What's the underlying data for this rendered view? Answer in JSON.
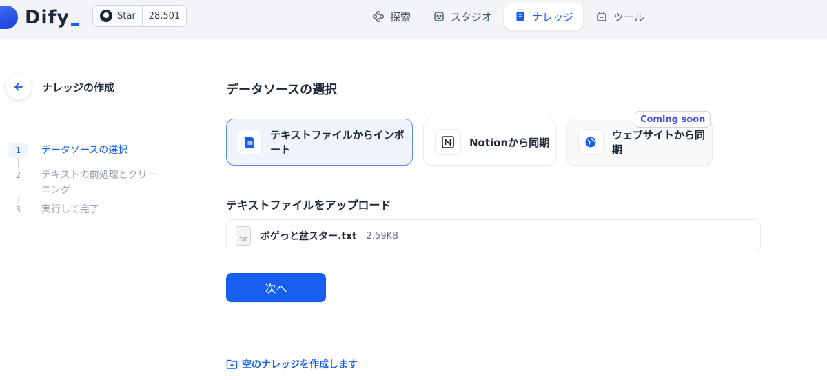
{
  "app": {
    "name": "Dify"
  },
  "github": {
    "star_label": "Star",
    "star_count": "28,501"
  },
  "nav": {
    "items": [
      {
        "label": "探索",
        "icon": "explore-icon",
        "active": false
      },
      {
        "label": "スタジオ",
        "icon": "studio-icon",
        "active": false
      },
      {
        "label": "ナレッジ",
        "icon": "knowledge-icon",
        "active": true
      },
      {
        "label": "ツール",
        "icon": "tools-icon",
        "active": false
      }
    ]
  },
  "sidebar": {
    "title": "ナレッジの作成",
    "steps": [
      {
        "num": "1",
        "label": "データソースの選択",
        "active": true
      },
      {
        "num": "2",
        "label": "テキストの前処理とクリーニング",
        "active": false
      },
      {
        "num": "3",
        "label": "実行して完了",
        "active": false
      }
    ]
  },
  "main": {
    "section_title": "データソースの選択",
    "sources": [
      {
        "label": "テキストファイルからインポート",
        "icon": "document-icon",
        "selected": true
      },
      {
        "label": "Notionから同期",
        "icon": "notion-icon",
        "selected": false
      },
      {
        "label": "ウェブサイトから同期",
        "icon": "globe-icon",
        "selected": false,
        "badge": "Coming soon"
      }
    ],
    "upload_title": "テキストファイルをアップロード",
    "file": {
      "type_label": "TXT",
      "name": "ボゲっと盆スター.txt",
      "size": "2.59KB"
    },
    "next_button": "次へ",
    "empty_link": "空のナレッジを作成します"
  },
  "colors": {
    "primary": "#155eef",
    "badge_text": "#444ce7"
  }
}
